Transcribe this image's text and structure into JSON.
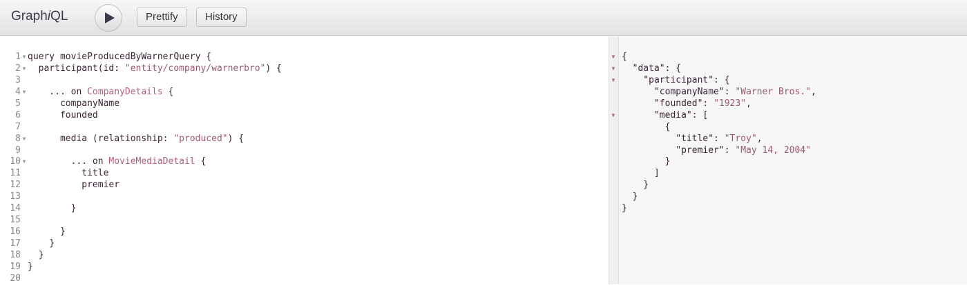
{
  "toolbar": {
    "logo_prefix": "Graph",
    "logo_i": "i",
    "logo_suffix": "QL",
    "prettify": "Prettify",
    "history": "History"
  },
  "query_lines": [
    {
      "n": "1",
      "fold": true,
      "t": [
        [
          "",
          "query movieProducedByWarnerQuery {"
        ]
      ]
    },
    {
      "n": "2",
      "fold": true,
      "t": [
        [
          "",
          "  participant(id: "
        ],
        [
          "str",
          "\"entity/company/warnerbro\""
        ],
        [
          "",
          ") {"
        ]
      ]
    },
    {
      "n": "3",
      "fold": false,
      "t": []
    },
    {
      "n": "4",
      "fold": true,
      "t": [
        [
          "",
          "    ... on "
        ],
        [
          "type",
          "CompanyDetails"
        ],
        [
          "",
          " {"
        ]
      ]
    },
    {
      "n": "5",
      "fold": false,
      "t": [
        [
          "",
          "      companyName"
        ]
      ]
    },
    {
      "n": "6",
      "fold": false,
      "t": [
        [
          "",
          "      founded"
        ]
      ]
    },
    {
      "n": "7",
      "fold": false,
      "t": []
    },
    {
      "n": "8",
      "fold": true,
      "t": [
        [
          "",
          "      media (relationship: "
        ],
        [
          "str",
          "\"produced\""
        ],
        [
          "",
          ") {"
        ]
      ]
    },
    {
      "n": "9",
      "fold": false,
      "t": []
    },
    {
      "n": "10",
      "fold": true,
      "t": [
        [
          "",
          "        ... on "
        ],
        [
          "type",
          "MovieMediaDetail"
        ],
        [
          "",
          " {"
        ]
      ]
    },
    {
      "n": "11",
      "fold": false,
      "t": [
        [
          "",
          "          title"
        ]
      ]
    },
    {
      "n": "12",
      "fold": false,
      "t": [
        [
          "",
          "          premier"
        ]
      ]
    },
    {
      "n": "13",
      "fold": false,
      "t": []
    },
    {
      "n": "14",
      "fold": false,
      "t": [
        [
          "",
          "        }"
        ]
      ]
    },
    {
      "n": "15",
      "fold": false,
      "t": []
    },
    {
      "n": "16",
      "fold": false,
      "t": [
        [
          "",
          "      }"
        ]
      ]
    },
    {
      "n": "17",
      "fold": false,
      "t": [
        [
          "",
          "    }"
        ]
      ]
    },
    {
      "n": "18",
      "fold": false,
      "t": [
        [
          "",
          "  }"
        ]
      ]
    },
    {
      "n": "19",
      "fold": false,
      "t": [
        [
          "",
          "}"
        ]
      ]
    },
    {
      "n": "20",
      "fold": false,
      "t": []
    }
  ],
  "result_lines": [
    {
      "fold": true,
      "t": [
        [
          "",
          "{"
        ]
      ]
    },
    {
      "fold": true,
      "t": [
        [
          "",
          "  \"data\": {"
        ]
      ]
    },
    {
      "fold": true,
      "t": [
        [
          "",
          "    \"participant\": {"
        ]
      ]
    },
    {
      "fold": false,
      "t": [
        [
          "",
          "      \"companyName\": "
        ],
        [
          "str",
          "\"Warner Bros.\""
        ],
        [
          "",
          ","
        ]
      ]
    },
    {
      "fold": false,
      "t": [
        [
          "",
          "      \"founded\": "
        ],
        [
          "str",
          "\"1923\""
        ],
        [
          "",
          ","
        ]
      ]
    },
    {
      "fold": true,
      "t": [
        [
          "",
          "      \"media\": ["
        ]
      ]
    },
    {
      "fold": false,
      "t": [
        [
          "",
          "        {"
        ]
      ]
    },
    {
      "fold": false,
      "t": [
        [
          "",
          "          \"title\": "
        ],
        [
          "str",
          "\"Troy\""
        ],
        [
          "",
          ","
        ]
      ]
    },
    {
      "fold": false,
      "t": [
        [
          "",
          "          \"premier\": "
        ],
        [
          "str",
          "\"May 14, 2004\""
        ]
      ]
    },
    {
      "fold": false,
      "t": [
        [
          "",
          "        }"
        ]
      ]
    },
    {
      "fold": false,
      "t": [
        [
          "",
          "      ]"
        ]
      ]
    },
    {
      "fold": false,
      "t": [
        [
          "",
          "    }"
        ]
      ]
    },
    {
      "fold": false,
      "t": [
        [
          "",
          "  }"
        ]
      ]
    },
    {
      "fold": false,
      "t": [
        [
          "",
          "}"
        ]
      ]
    }
  ]
}
